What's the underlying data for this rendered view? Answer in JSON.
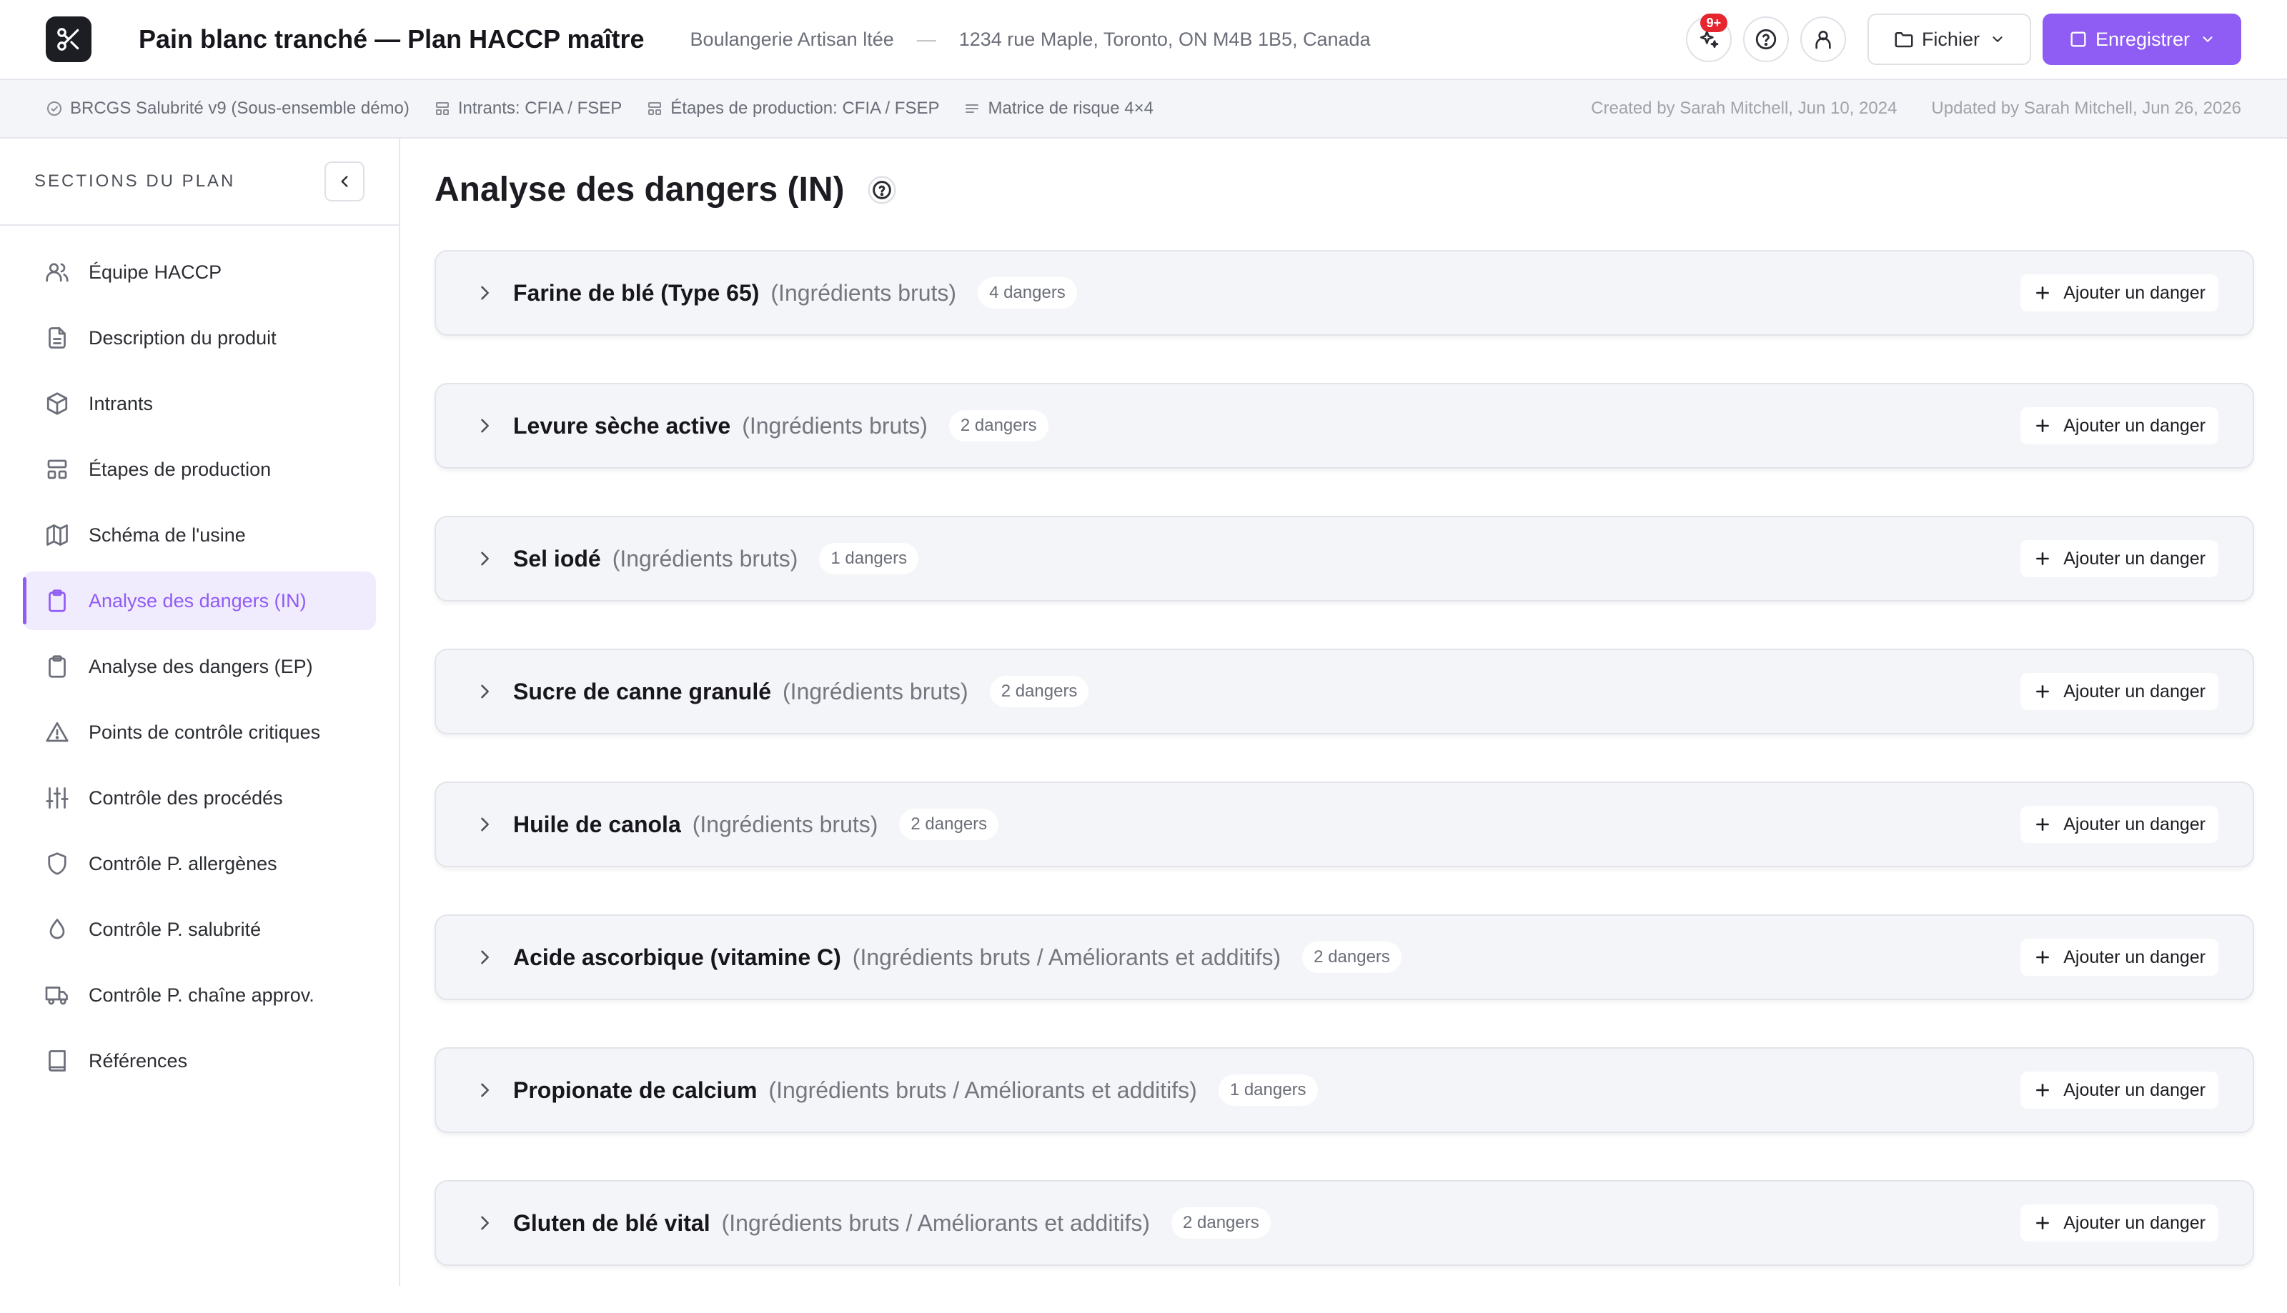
{
  "header": {
    "title": "Pain blanc tranché — Plan HACCP maître",
    "company": "Boulangerie Artisan ltée",
    "separator": "—",
    "address": "1234 rue Maple, Toronto, ON M4B 1B5, Canada",
    "notifications_badge": "9+",
    "file_label": "Fichier",
    "save_label": "Enregistrer",
    "accent_color": "#8f5cf4",
    "badge_color": "#e5262f"
  },
  "subbar": {
    "items": [
      {
        "icon": "check-circle-icon",
        "label": "BRCGS Salubrité v9 (Sous-ensemble démo)"
      },
      {
        "icon": "layout-icon",
        "label": "Intrants: CFIA / FSEP"
      },
      {
        "icon": "layout-icon",
        "label": "Étapes de production: CFIA / FSEP"
      },
      {
        "icon": "lines-icon",
        "label": "Matrice de risque 4×4"
      }
    ],
    "created": "Created by Sarah Mitchell, Jun 10, 2024",
    "updated": "Updated by Sarah Mitchell, Jun 26, 2026"
  },
  "sidebar": {
    "title": "SECTIONS DU PLAN",
    "items": [
      {
        "label": "Équipe HACCP",
        "icon": "users-icon"
      },
      {
        "label": "Description du produit",
        "icon": "document-icon"
      },
      {
        "label": "Intrants",
        "icon": "box-icon"
      },
      {
        "label": "Étapes de production",
        "icon": "steps-icon"
      },
      {
        "label": "Schéma de l'usine",
        "icon": "map-icon"
      },
      {
        "label": "Analyse des dangers (IN)",
        "icon": "clipboard-icon",
        "active": true
      },
      {
        "label": "Analyse des dangers (EP)",
        "icon": "clipboard-icon"
      },
      {
        "label": "Points de contrôle critiques",
        "icon": "warning-icon"
      },
      {
        "label": "Contrôle des procédés",
        "icon": "sliders-icon"
      },
      {
        "label": "Contrôle P. allergènes",
        "icon": "shield-icon"
      },
      {
        "label": "Contrôle P. salubrité",
        "icon": "droplet-icon"
      },
      {
        "label": "Contrôle P. chaîne approv.",
        "icon": "truck-icon"
      },
      {
        "label": "Références",
        "icon": "book-icon"
      }
    ]
  },
  "main": {
    "title": "Analyse des dangers (IN)",
    "add_label": "Ajouter un danger",
    "ingredients": [
      {
        "name": "Farine de blé (Type 65)",
        "category": "(Ingrédients bruts)",
        "count": "4 dangers"
      },
      {
        "name": "Levure sèche active",
        "category": "(Ingrédients bruts)",
        "count": "2 dangers"
      },
      {
        "name": "Sel iodé",
        "category": "(Ingrédients bruts)",
        "count": "1 dangers"
      },
      {
        "name": "Sucre de canne granulé",
        "category": "(Ingrédients bruts)",
        "count": "2 dangers"
      },
      {
        "name": "Huile de canola",
        "category": "(Ingrédients bruts)",
        "count": "2 dangers"
      },
      {
        "name": "Acide ascorbique (vitamine C)",
        "category": "(Ingrédients bruts / Améliorants et additifs)",
        "count": "2 dangers"
      },
      {
        "name": "Propionate de calcium",
        "category": "(Ingrédients bruts / Améliorants et additifs)",
        "count": "1 dangers"
      },
      {
        "name": "Gluten de blé vital",
        "category": "(Ingrédients bruts / Améliorants et additifs)",
        "count": "2 dangers"
      }
    ]
  }
}
